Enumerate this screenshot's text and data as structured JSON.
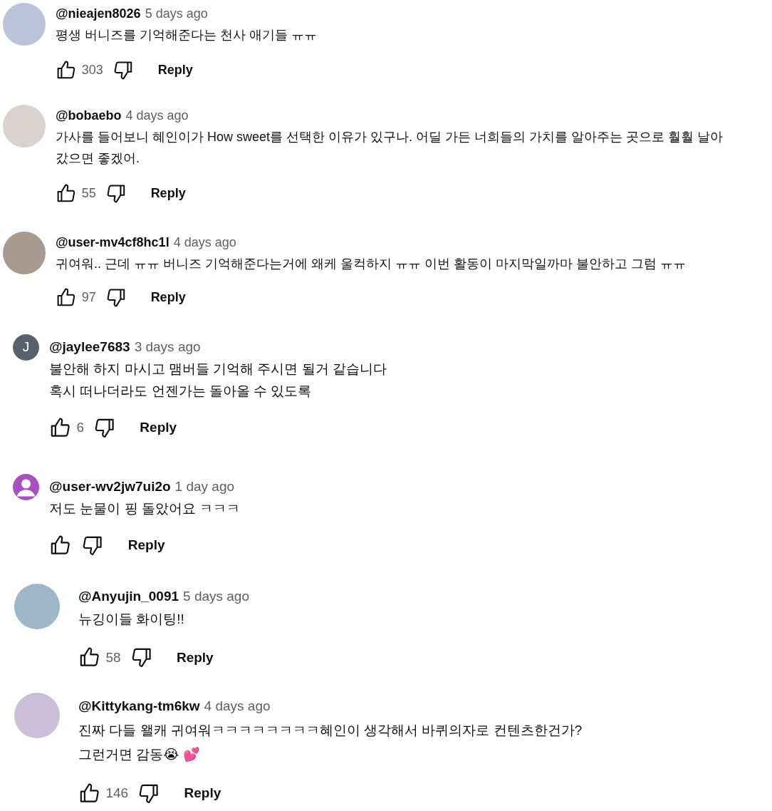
{
  "comments": [
    {
      "kind": "comment",
      "avatar": {
        "kind": "photo"
      },
      "author": "@nieajen8026",
      "time": "5 days ago",
      "body": [
        "평생 버니즈를 기억해준다는 천사 애기들 ㅠㅠ"
      ],
      "likes": "303",
      "reply": "Reply"
    },
    {
      "kind": "comment",
      "avatar": {
        "kind": "photo"
      },
      "author": "@bobaebo",
      "time": "4 days ago",
      "body": [
        "가사를 들어보니 혜인이가 How sweet를 선택한 이유가 있구나. 어딜 가든 너희들의 가치를 알아주는 곳으로 훨훨 날아 갔으면 좋겠어."
      ],
      "likes": "55",
      "reply": "Reply"
    },
    {
      "kind": "comment",
      "avatar": {
        "kind": "photo"
      },
      "author": "@user-mv4cf8hc1l",
      "time": "4 days ago",
      "body": [
        "귀여워.. 근데 ㅠㅠ 버니즈 기억해준다는거에 왜케 울컥하지 ㅠㅠ 이번 활동이 마지막일까마 불안하고 그럼 ㅠㅠ"
      ],
      "likes": "97",
      "reply": "Reply"
    },
    {
      "kind": "comment",
      "avatar": {
        "kind": "letter",
        "letter": "J",
        "color": "#56626e"
      },
      "author": "@jaylee7683",
      "time": "3 days ago",
      "body": [
        "불안해 하지 마시고 맴버들 기억해 주시면 될거 같습니다",
        "혹시 떠나더라도 언젠가는 돌아올 수 있도록"
      ],
      "likes": "6",
      "reply": "Reply"
    },
    {
      "kind": "comment",
      "avatar": {
        "kind": "silhouette",
        "color": "#a94fc4"
      },
      "author": "@user-wv2jw7ui2o",
      "time": "1 day ago",
      "body": [
        "저도 눈물이 핑 돌았어요 ㅋㅋㅋ"
      ],
      "reply": "Reply"
    },
    {
      "kind": "reply",
      "avatar": {
        "kind": "photo"
      },
      "author": "@Anyujin_0091",
      "time": "5 days ago",
      "body": [
        "뉴깅이들 화이팅!!"
      ],
      "likes": "58",
      "reply": "Reply"
    },
    {
      "kind": "reply",
      "avatar": {
        "kind": "photo"
      },
      "author": "@Kittykang-tm6kw",
      "time": "4 days ago",
      "body": [
        "진짜 다들 왤캐 귀여워ㅋㅋㅋㅋㅋㅋㅋㅋ혜인이 생각해서 바퀴의자로 컨텐츠한건가?",
        "그런거면 감동😭 💕"
      ],
      "likes": "146",
      "reply": "Reply"
    }
  ]
}
